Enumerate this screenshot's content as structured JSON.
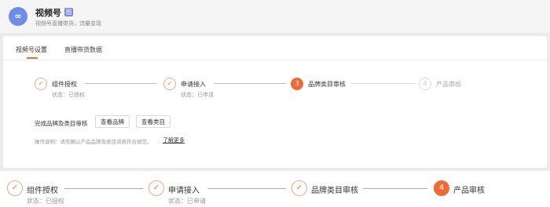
{
  "header": {
    "logo_text": "∞",
    "app_name": "视频号",
    "tag": "图",
    "description": "视频号直播带货，流量变现"
  },
  "tabs": [
    {
      "label": "视频号设置",
      "active": true
    },
    {
      "label": "直播带货数据",
      "active": false
    }
  ],
  "steps": [
    {
      "number": "✓",
      "label": "组件授权",
      "status": "状态：已授权",
      "state": "done"
    },
    {
      "number": "✓",
      "label": "申请接入",
      "status": "状态：已申请",
      "state": "done"
    },
    {
      "number": "3",
      "label": "品牌类目审核",
      "status": "",
      "state": "current"
    },
    {
      "number": "4",
      "label": "产品审核",
      "status": "",
      "state": "pending"
    }
  ],
  "brand_section": {
    "label": "完成品牌及类目审核",
    "view_brand_button": "查看品牌",
    "view_category_button": "查看类目"
  },
  "note": {
    "text": "操作说明：请先确认产品品牌及类目资质符合规范。",
    "link": "了解更多"
  },
  "bottom_steps": [
    {
      "number": "✓",
      "label": "组件授权",
      "status": "状态：已授权",
      "state": "done"
    },
    {
      "number": "✓",
      "label": "申请接入",
      "status": "状态：已申请",
      "state": "done"
    },
    {
      "number": "✓",
      "label": "品牌类目审核",
      "status": "",
      "state": "done"
    },
    {
      "number": "4",
      "label": "产品审核",
      "status": "",
      "state": "current"
    }
  ],
  "colors": {
    "accent": "#f06a35",
    "done_border": "#f3a984",
    "page_bg": "#ebebeb"
  }
}
